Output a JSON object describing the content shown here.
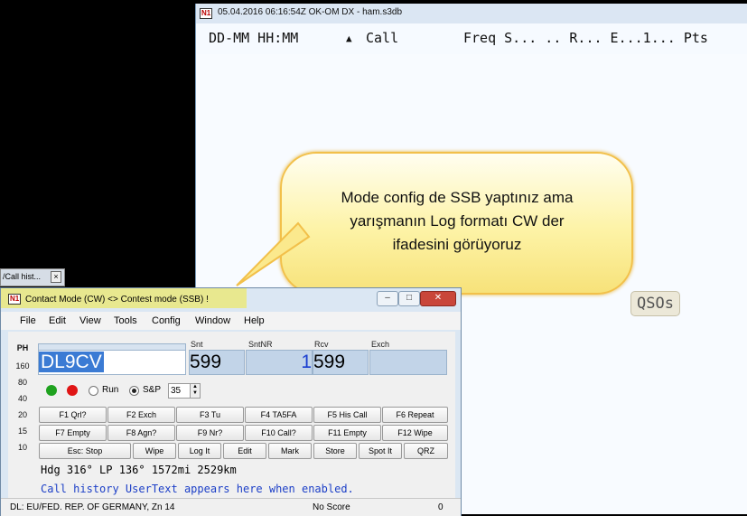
{
  "log_window": {
    "logo": "N1",
    "title": "05.04.2016 06:16:54Z  OK-OM DX - ham.s3db",
    "columns": {
      "datetime": "DD-MM HH:MM",
      "sort_arrow": "▲",
      "call": "Call",
      "rest": "Freq S... .. R... E...1... Pts"
    },
    "qsos_label": "QSOs"
  },
  "callout": {
    "lines": [
      "Mode config de SSB yaptınız ama",
      "yarışmanın Log formatı  CW der",
      "ifadesini görüyoruz"
    ]
  },
  "small_window": {
    "title": "/Call hist...",
    "close": "×"
  },
  "entry_window": {
    "logo": "N1",
    "title": "Contact Mode (CW) <> Contest mode (SSB) !",
    "min": "–",
    "max": "□",
    "close": "✕",
    "menu": [
      "File",
      "Edit",
      "View",
      "Tools",
      "Config",
      "Window",
      "Help"
    ],
    "bands": [
      "PH",
      "160",
      "80",
      "40",
      "20",
      "15",
      "10"
    ],
    "field_labels": {
      "snt": "Snt",
      "sntnr": "SntNR",
      "rcv": "Rcv",
      "exch": "Exch"
    },
    "fields": {
      "call": "DL9CV",
      "snt": "599",
      "sntnr": "1",
      "rcv": "599",
      "exch": ""
    },
    "radio": {
      "run": "Run",
      "sp": "S&P",
      "sp_selected": true
    },
    "spinner_value": "35",
    "fkeys_row1": [
      "F1 Qrl?",
      "F2 Exch",
      "F3 Tu",
      "F4 TA5FA",
      "F5 His Call",
      "F6 Repeat"
    ],
    "fkeys_row2": [
      "F7 Empty",
      "F8 Agn?",
      "F9 Nr?",
      "F10 Call?",
      "F11 Empty",
      "F12 Wipe"
    ],
    "buttons_row3": [
      "Esc: Stop",
      "Wipe",
      "Log It",
      "Edit",
      "Mark",
      "Store",
      "Spot It",
      "QRZ"
    ],
    "heading_info": "Hdg 316° LP 136° 1572mi 2529km",
    "userinfo": "Call history UserText appears here when enabled.",
    "status_left": "DL: EU/FED. REP. OF GERMANY, Zn 14",
    "status_mid": "No Score",
    "status_right": "0"
  },
  "colors": {
    "green_led": "#1fa21f",
    "red_led": "#e01515",
    "callout_border": "#f2c04a",
    "highlight": "#f3ea3c"
  }
}
